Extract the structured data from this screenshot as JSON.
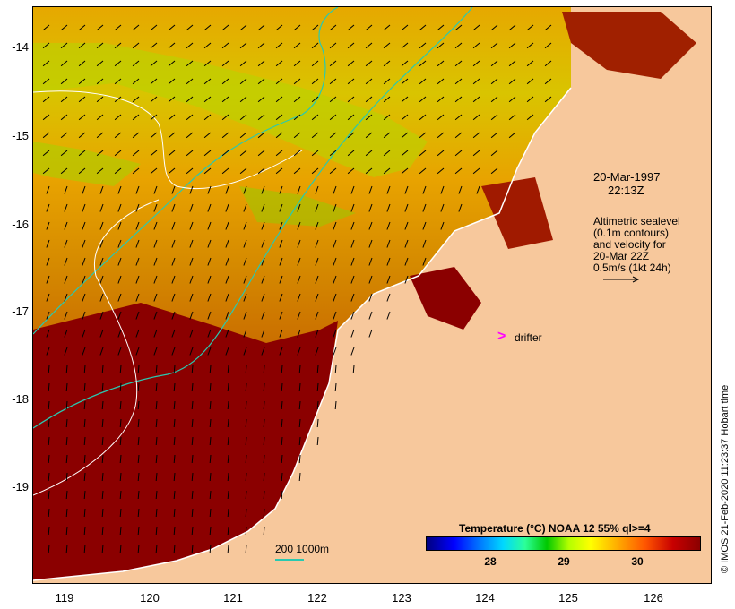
{
  "map": {
    "lat_ticks": [
      "-14",
      "-15",
      "-16",
      "-17",
      "-18",
      "-19"
    ],
    "lon_ticks": [
      "119",
      "120",
      "121",
      "122",
      "123",
      "124",
      "125",
      "126"
    ],
    "lat_range": [
      -20.05,
      -13.5
    ],
    "lon_range": [
      118.65,
      126.7
    ],
    "land_color": "#f7c89c",
    "hot_color": "#8b0000",
    "contour_color_cyan": "#29c9b0",
    "contour_color_white": "#ffffff"
  },
  "info": {
    "date": "20-Mar-1997",
    "time": "22:13Z",
    "line1": "Altimetric sealevel",
    "line2": "(0.1m contours)",
    "line3": "and velocity for",
    "line4": "20-Mar 22Z",
    "line5": "0.5m/s (1kt 24h)"
  },
  "drifter": {
    "symbol": ">",
    "label": "drifter",
    "color": "#ff00ff"
  },
  "scale": {
    "label": "200  1000m"
  },
  "colorbar": {
    "title": "Temperature (°C) NOAA 12 55% ql>=4",
    "ticks": [
      "28",
      "29",
      "30"
    ]
  },
  "credit": "© IMOS 21-Feb-2020 11:23:37 Hobart time"
}
